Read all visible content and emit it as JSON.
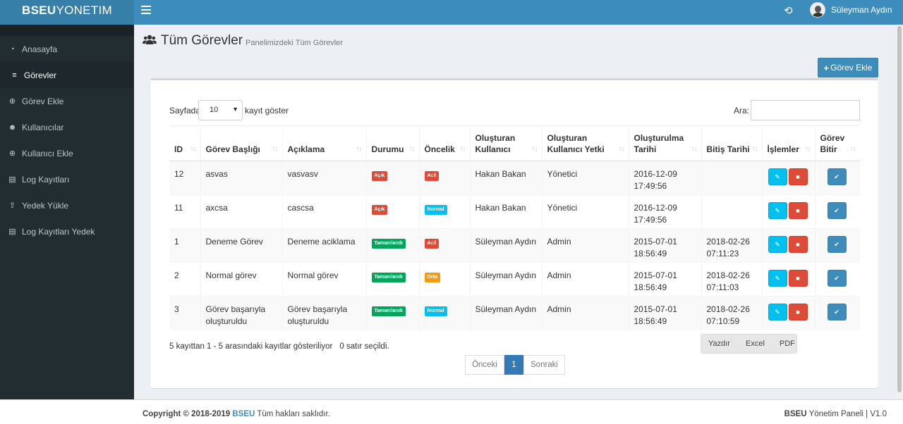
{
  "header": {
    "logo_bold": "BSEU",
    "logo_rest": "YONETIM",
    "user_name": "Süleyman Aydın",
    "icons": [
      "hamburger-icon",
      "history-icon",
      "user-avatar"
    ]
  },
  "sidebar": {
    "items": [
      {
        "label": "Anasayfa",
        "icon": "dashboard-icon",
        "active": false
      },
      {
        "label": "Görevler",
        "icon": "list-icon",
        "active": true
      },
      {
        "label": "Görev Ekle",
        "icon": "plus-circle-icon",
        "active": false
      },
      {
        "label": "Kullanıcılar",
        "icon": "users-icon",
        "active": false
      },
      {
        "label": "Kullanıcı Ekle",
        "icon": "plus-circle-icon",
        "active": false
      },
      {
        "label": "Log Kayıtları",
        "icon": "log-icon",
        "active": false
      },
      {
        "label": "Yedek Yükle",
        "icon": "upload-icon",
        "active": false
      },
      {
        "label": "Log Kayıtları Yedek",
        "icon": "log-icon",
        "active": false
      }
    ]
  },
  "page": {
    "title": "Tüm Görevler",
    "subtitle": "Panelimizdeki Tüm Görevler",
    "add_button": "Görev Ekle"
  },
  "table_controls": {
    "length_prefix": "Sayfada",
    "length_value": "10",
    "length_suffix": "kayıt göster",
    "search_label": "Ara:",
    "search_value": ""
  },
  "table": {
    "columns": [
      "ID",
      "Görev Başlığı",
      "Açıklama",
      "Durumu",
      "Öncelik",
      "Oluşturan Kullanıcı",
      "Oluşturan Kullanıcı Yetki",
      "Oluşturulma Tarihi",
      "Bitiş Tarihi",
      "İşlemler",
      "Görev Bitir"
    ],
    "rows": [
      {
        "id": "12",
        "title": "asvas",
        "desc": "vasvasv",
        "status": "Açık",
        "priority": "Acil",
        "user": "Hakan Bakan",
        "role": "Yönetici",
        "created_date": "2016-12-09",
        "created_time": "17:49:56",
        "end_date": "",
        "end_time": ""
      },
      {
        "id": "11",
        "title": "axcsa",
        "desc": "cascsa",
        "status": "Açık",
        "priority": "Normal",
        "user": "Hakan Bakan",
        "role": "Yönetici",
        "created_date": "2016-12-09",
        "created_time": "17:49:56",
        "end_date": "",
        "end_time": ""
      },
      {
        "id": "1",
        "title": "Deneme Görev",
        "desc": "Deneme aciklama",
        "status": "Tamamlandı",
        "priority": "Acil",
        "user": "Süleyman Aydın",
        "role": "Admin",
        "created_date": "2015-07-01",
        "created_time": "18:56:49",
        "end_date": "2018-02-26",
        "end_time": "07:11:23"
      },
      {
        "id": "2",
        "title": "Normal görev",
        "desc": "Normal görev",
        "status": "Tamamlandı",
        "priority": "Orta",
        "user": "Süleyman Aydın",
        "role": "Admin",
        "created_date": "2015-07-01",
        "created_time": "18:56:49",
        "end_date": "2018-02-26",
        "end_time": "07:11:03"
      },
      {
        "id": "3",
        "title": "Görev başarıyla oluşturuldu",
        "desc": "Görev başarıyla oluşturuldu",
        "status": "Tamamlandı",
        "priority": "Normal",
        "user": "Süleyman Aydın",
        "role": "Admin",
        "created_date": "2015-07-01",
        "created_time": "18:56:49",
        "end_date": "2018-02-26",
        "end_time": "07:10:59"
      }
    ]
  },
  "badge_colors": {
    "Açık": "#dd4b39",
    "Tamamlandı": "#00a65a",
    "Acil": "#dd4b39",
    "Normal": "#00c0ef",
    "Orta": "#f39c12"
  },
  "footer_table": {
    "info": "5 kayıttan 1 - 5 arasındaki kayıtlar gösteriliyor",
    "selected": "0 satır seçildi.",
    "export_buttons": [
      "Yazdır",
      "Excel",
      "PDF"
    ],
    "pager": {
      "prev": "Önceki",
      "current": "1",
      "next": "Sonraki"
    }
  },
  "footer": {
    "copyright_bold": "Copyright © 2018-2019",
    "brand": "BSEU",
    "rights": "Tüm hakları saklıdır.",
    "right_bold": "BSEU",
    "right_text": "Yönetim Paneli | V1.0"
  }
}
